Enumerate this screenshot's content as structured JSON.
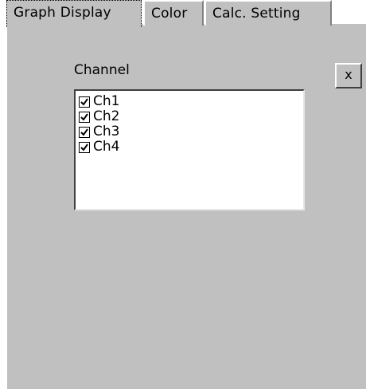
{
  "tabs": [
    {
      "label": "Graph Display",
      "active": true
    },
    {
      "label": "Color",
      "active": false
    },
    {
      "label": "Calc. Setting",
      "active": false
    }
  ],
  "channel": {
    "label": "Channel",
    "items": [
      {
        "label": "Ch1",
        "checked": true
      },
      {
        "label": "Ch2",
        "checked": true
      },
      {
        "label": "Ch3",
        "checked": true
      },
      {
        "label": "Ch4",
        "checked": true
      }
    ]
  },
  "close_button": {
    "label": "x"
  },
  "colors": {
    "panel": "#c0c0c0",
    "list": "#ffffff"
  }
}
